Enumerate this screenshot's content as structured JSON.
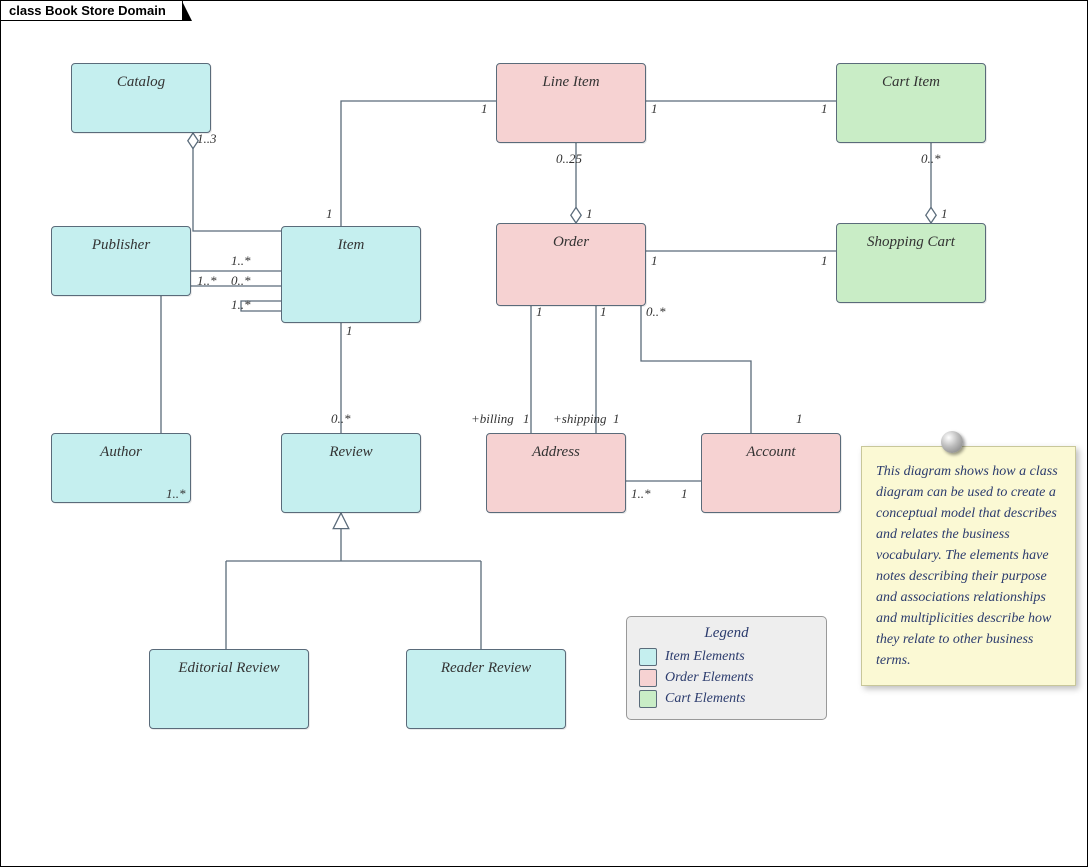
{
  "title": "class Book Store Domain",
  "boxes": {
    "catalog": "Catalog",
    "publisher": "Publisher",
    "author": "Author",
    "item": "Item",
    "review": "Review",
    "editorial": "Editorial Review",
    "reader": "Reader Review",
    "lineitem": "Line Item",
    "order": "Order",
    "address": "Address",
    "account": "Account",
    "cartitem": "Cart Item",
    "shoppingcart": "Shopping Cart"
  },
  "mults": {
    "catalog_item": "1..3",
    "item_catalog": "1",
    "publisher_item": "1..*",
    "item_publisher": "1..*",
    "author_item": "1..*",
    "item_author": "0..*",
    "item_subitem": "1..*",
    "item_review": "1",
    "review_item": "0..*",
    "item_lineitem": "1",
    "lineitem_item": "1",
    "lineitem_order": "0..25",
    "order_lineitem": "1",
    "lineitem_cartitem": "1",
    "cartitem_lineitem": "1",
    "cartitem_cart": "0..*",
    "cart_cartitem": "1",
    "order_cart": "1",
    "cart_order": "1",
    "order_account": "0..*",
    "account_order": "1",
    "order_addr_b": "1",
    "order_addr_s": "1",
    "addr_b_role": "+billing",
    "addr_b_mult": "1",
    "addr_s_role": "+shipping",
    "addr_s_mult": "1",
    "address_account": "1..*",
    "account_address": "1"
  },
  "legend": {
    "title": "Legend",
    "items": [
      {
        "label": "Item Elements",
        "class": "c-item"
      },
      {
        "label": "Order Elements",
        "class": "c-order"
      },
      {
        "label": "Cart Elements",
        "class": "c-cart"
      }
    ]
  },
  "note": "This diagram shows how a class diagram can be used to create a conceptual model that describes and relates the business vocabulary. The elements have notes describing their purpose and associations relationships and multiplicities describe how they relate to other business terms.",
  "chart_data": {
    "type": "uml-class",
    "classes": [
      {
        "name": "Catalog",
        "group": "Item"
      },
      {
        "name": "Publisher",
        "group": "Item"
      },
      {
        "name": "Author",
        "group": "Item"
      },
      {
        "name": "Item",
        "group": "Item"
      },
      {
        "name": "Review",
        "group": "Item"
      },
      {
        "name": "Editorial Review",
        "group": "Item"
      },
      {
        "name": "Reader Review",
        "group": "Item"
      },
      {
        "name": "Line Item",
        "group": "Order"
      },
      {
        "name": "Order",
        "group": "Order"
      },
      {
        "name": "Address",
        "group": "Order"
      },
      {
        "name": "Account",
        "group": "Order"
      },
      {
        "name": "Cart Item",
        "group": "Cart"
      },
      {
        "name": "Shopping Cart",
        "group": "Cart"
      }
    ],
    "relations": [
      {
        "from": "Catalog",
        "to": "Item",
        "type": "aggregation",
        "from_mult": "",
        "to_mult": "1..3",
        "agg_at": "Catalog",
        "end_mult": "1"
      },
      {
        "from": "Publisher",
        "to": "Item",
        "type": "association",
        "from_mult": "1..*",
        "to_mult": "1..*"
      },
      {
        "from": "Author",
        "to": "Item",
        "type": "association",
        "from_mult": "1..*",
        "to_mult": "0..*"
      },
      {
        "from": "Item",
        "to": "Item",
        "type": "association",
        "from_mult": "",
        "to_mult": "1..*",
        "self": true
      },
      {
        "from": "Item",
        "to": "Review",
        "type": "association",
        "from_mult": "1",
        "to_mult": "0..*"
      },
      {
        "from": "Item",
        "to": "Line Item",
        "type": "association",
        "from_mult": "1",
        "to_mult": "1"
      },
      {
        "from": "Line Item",
        "to": "Cart Item",
        "type": "association",
        "from_mult": "1",
        "to_mult": "1"
      },
      {
        "from": "Order",
        "to": "Line Item",
        "type": "aggregation",
        "from_mult": "1",
        "to_mult": "0..25",
        "agg_at": "Order"
      },
      {
        "from": "Shopping Cart",
        "to": "Cart Item",
        "type": "aggregation",
        "from_mult": "1",
        "to_mult": "0..*",
        "agg_at": "Shopping Cart"
      },
      {
        "from": "Order",
        "to": "Shopping Cart",
        "type": "association",
        "from_mult": "1",
        "to_mult": "1"
      },
      {
        "from": "Order",
        "to": "Account",
        "type": "association",
        "from_mult": "0..*",
        "to_mult": "1"
      },
      {
        "from": "Order",
        "to": "Address",
        "type": "association",
        "role": "+billing",
        "from_mult": "1",
        "to_mult": "1"
      },
      {
        "from": "Order",
        "to": "Address",
        "type": "association",
        "role": "+shipping",
        "from_mult": "1",
        "to_mult": "1"
      },
      {
        "from": "Address",
        "to": "Account",
        "type": "association",
        "from_mult": "1..*",
        "to_mult": "1"
      },
      {
        "from": "Editorial Review",
        "to": "Review",
        "type": "generalization"
      },
      {
        "from": "Reader Review",
        "to": "Review",
        "type": "generalization"
      }
    ]
  }
}
